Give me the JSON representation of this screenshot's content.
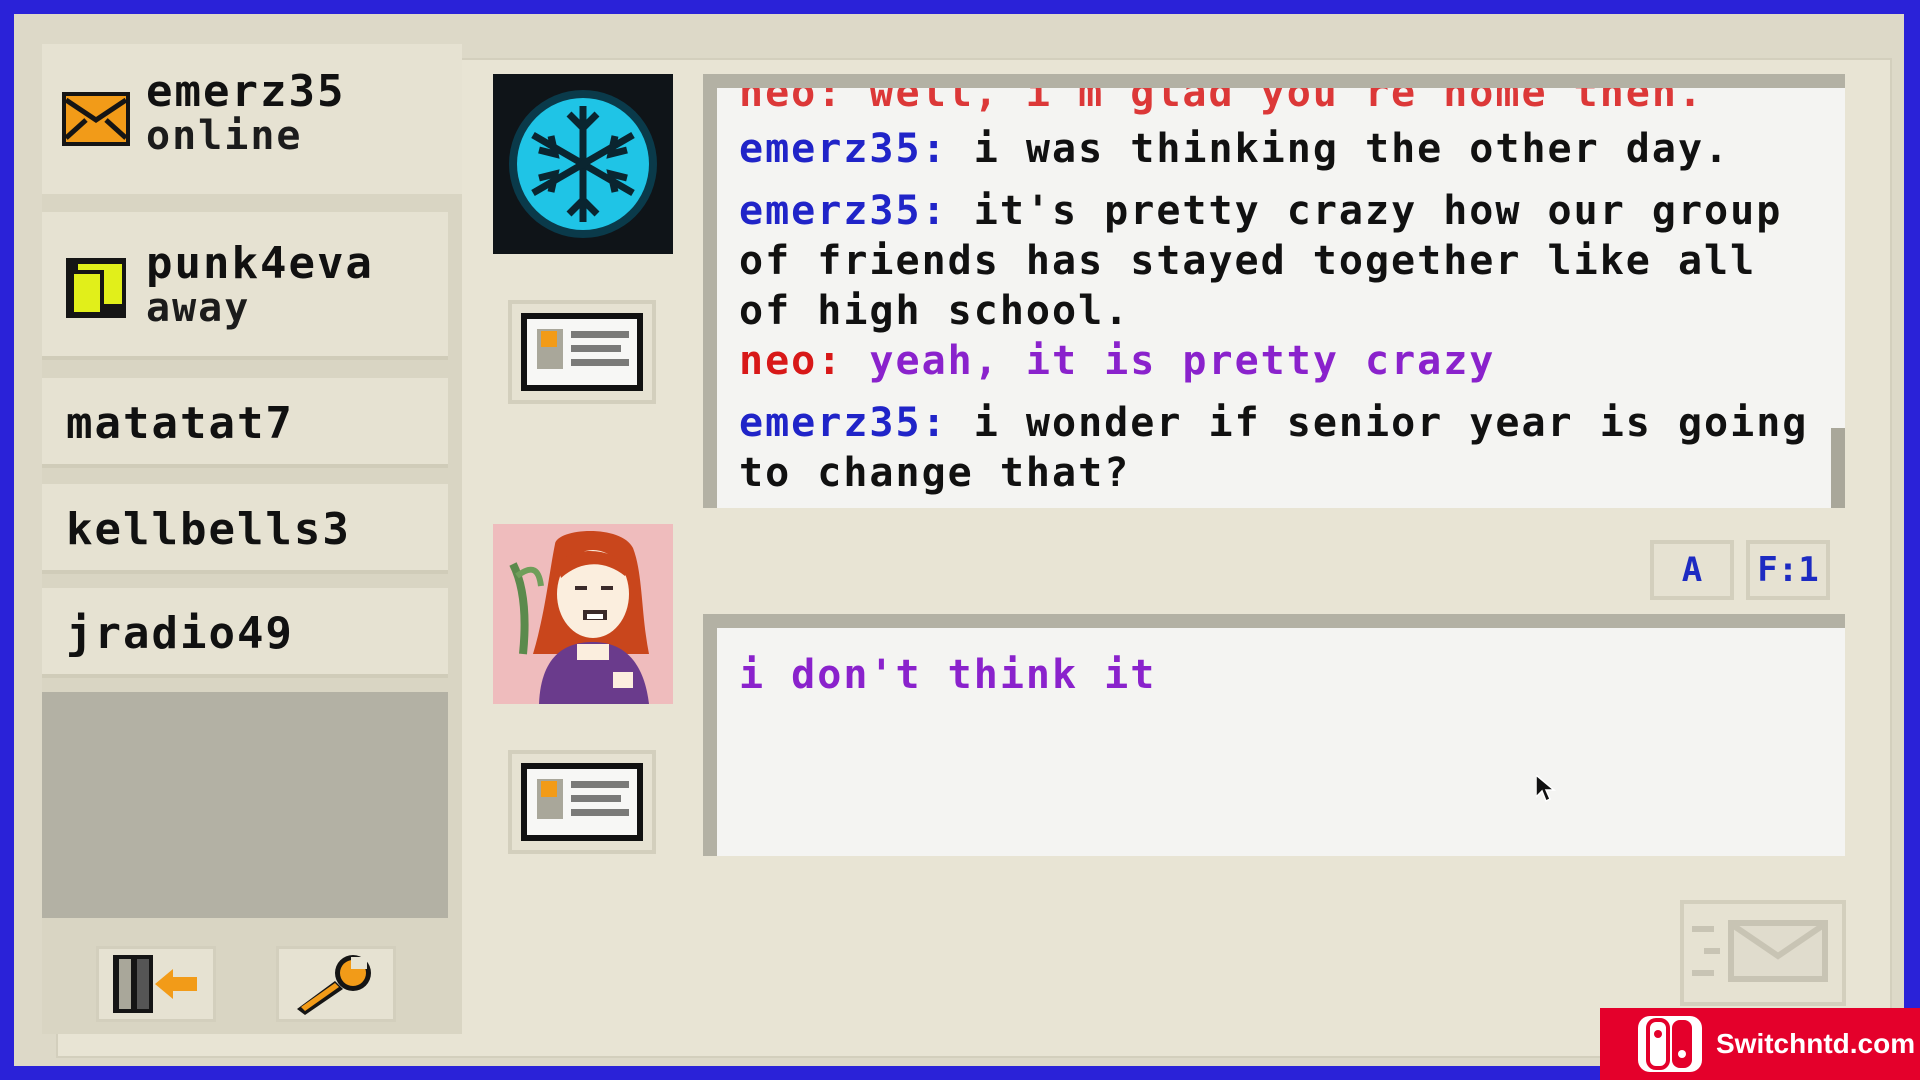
{
  "user": {
    "name": "emerz35",
    "status": "online"
  },
  "contacts": [
    {
      "name": "punk4eva",
      "status": "away"
    },
    {
      "name": "matatat7"
    },
    {
      "name": "kellbells3"
    },
    {
      "name": "jradio49"
    }
  ],
  "chat": {
    "partial_line": "neo: well, i'm glad you're home then.",
    "messages": [
      {
        "sender": "emerz35:",
        "text": "i was thinking the other day."
      },
      {
        "sender": "emerz35:",
        "text": "it's pretty crazy how our group of friends has stayed together like all of high school."
      },
      {
        "sender": "neo:",
        "text": "yeah, it is pretty crazy"
      },
      {
        "sender": "emerz35:",
        "text": "i wonder if senior year is going to change that?"
      }
    ]
  },
  "format_buttons": {
    "font": "A",
    "size": "F:1"
  },
  "compose": {
    "text": "i don't think it"
  },
  "watermark": {
    "text": "Switchntd.com"
  },
  "colors": {
    "emerz_name": "#2024c8",
    "neo_name": "#d81818",
    "neo_text": "#8a22cc",
    "frame": "#2a22d8"
  },
  "icons": {
    "unread_mail": "envelope-icon",
    "away": "moon-note-icon",
    "logout": "door-exit-icon",
    "settings": "wrench-icon",
    "profile": "id-card-icon",
    "send": "send-envelope-icon"
  }
}
